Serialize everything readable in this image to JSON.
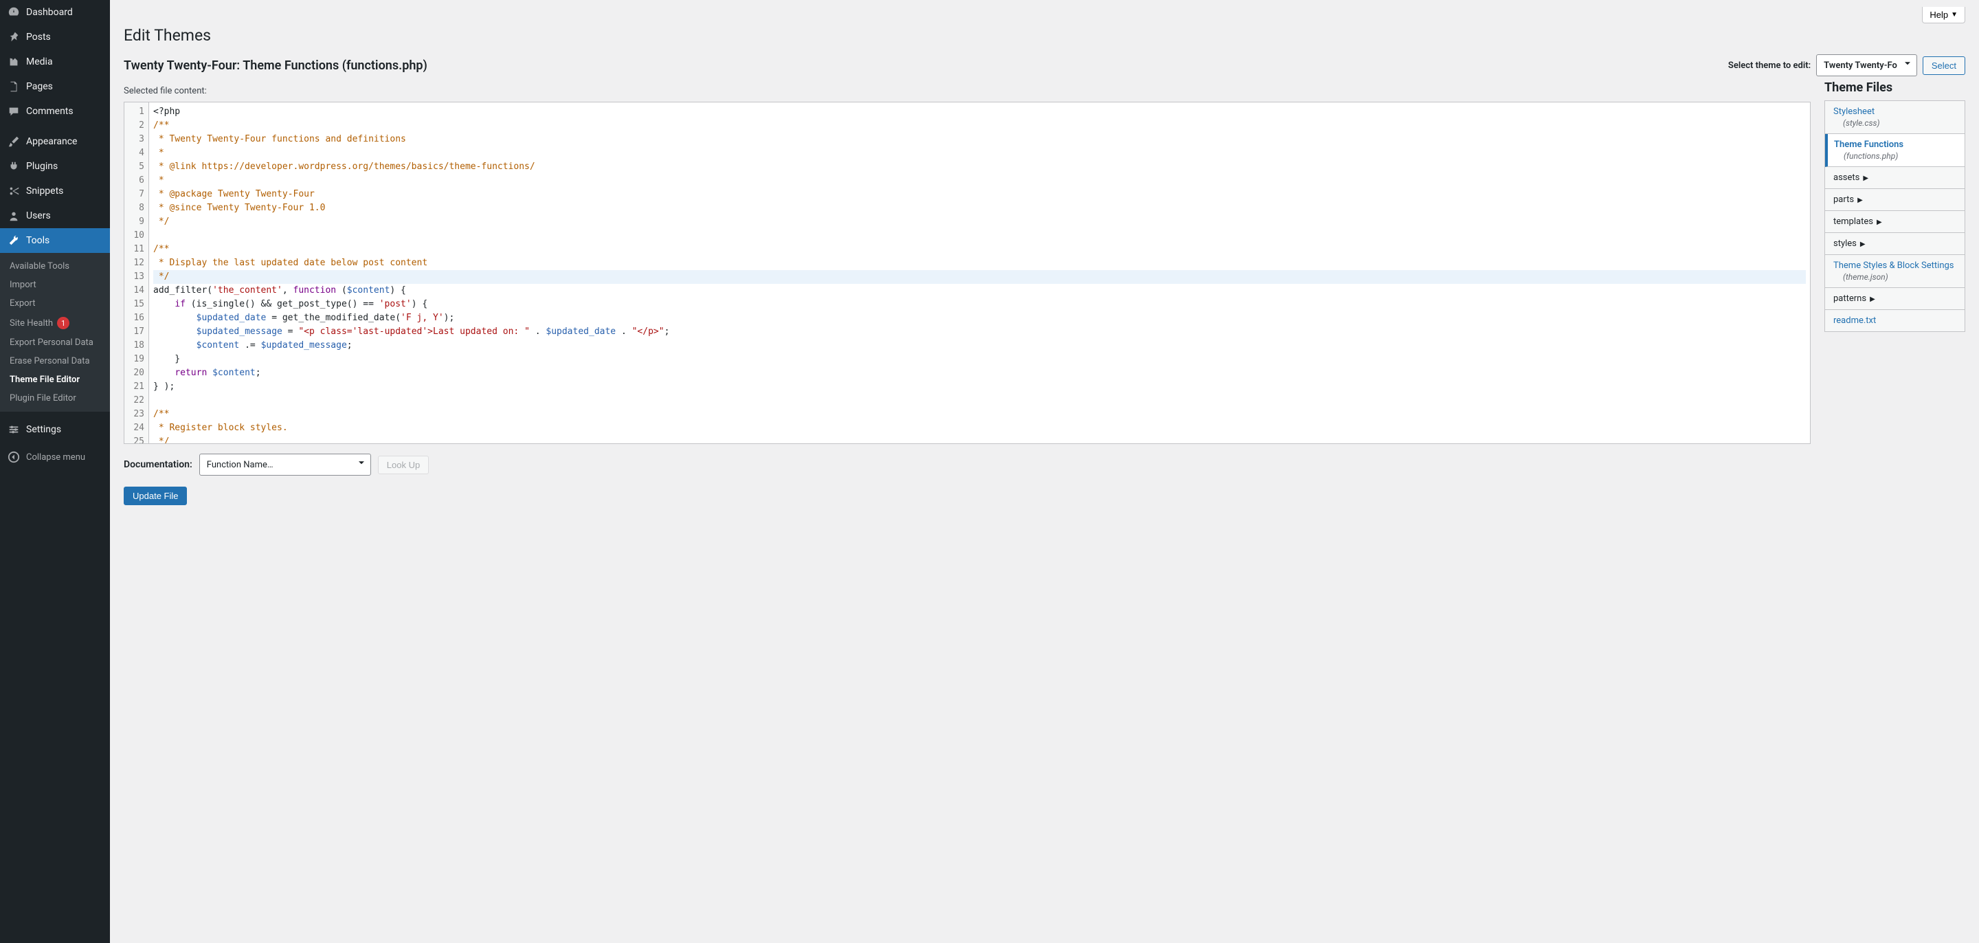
{
  "sidebar": {
    "items": [
      {
        "label": "Dashboard",
        "icon": "dashboard"
      },
      {
        "label": "Posts",
        "icon": "pin"
      },
      {
        "label": "Media",
        "icon": "media"
      },
      {
        "label": "Pages",
        "icon": "page"
      },
      {
        "label": "Comments",
        "icon": "comment"
      },
      {
        "label": "Appearance",
        "icon": "brush"
      },
      {
        "label": "Plugins",
        "icon": "plug"
      },
      {
        "label": "Snippets",
        "icon": "scissors"
      },
      {
        "label": "Users",
        "icon": "user"
      },
      {
        "label": "Tools",
        "icon": "wrench",
        "current": true
      },
      {
        "label": "Settings",
        "icon": "sliders"
      }
    ],
    "tools_submenu": [
      {
        "label": "Available Tools"
      },
      {
        "label": "Import"
      },
      {
        "label": "Export"
      },
      {
        "label": "Site Health",
        "badge": "1"
      },
      {
        "label": "Export Personal Data"
      },
      {
        "label": "Erase Personal Data"
      },
      {
        "label": "Theme File Editor",
        "current": true
      },
      {
        "label": "Plugin File Editor"
      }
    ],
    "collapse": "Collapse menu"
  },
  "help_label": "Help",
  "page_title": "Edit Themes",
  "file_heading": "Twenty Twenty-Four: Theme Functions (functions.php)",
  "theme_select": {
    "label": "Select theme to edit:",
    "value": "Twenty Twenty-Fo",
    "button": "Select"
  },
  "selected_file_label": "Selected file content:",
  "code_lines": [
    [
      {
        "t": "<?php",
        "c": ""
      }
    ],
    [
      {
        "t": "/**",
        "c": "c-cmt"
      }
    ],
    [
      {
        "t": " * Twenty Twenty-Four functions and definitions",
        "c": "c-cmt"
      }
    ],
    [
      {
        "t": " *",
        "c": "c-cmt"
      }
    ],
    [
      {
        "t": " * @link https://developer.wordpress.org/themes/basics/theme-functions/",
        "c": "c-cmt"
      }
    ],
    [
      {
        "t": " *",
        "c": "c-cmt"
      }
    ],
    [
      {
        "t": " * @package Twenty Twenty-Four",
        "c": "c-cmt"
      }
    ],
    [
      {
        "t": " * @since Twenty Twenty-Four 1.0",
        "c": "c-cmt"
      }
    ],
    [
      {
        "t": " */",
        "c": "c-cmt"
      }
    ],
    [
      {
        "t": "",
        "c": ""
      }
    ],
    [
      {
        "t": "/**",
        "c": "c-cmt"
      }
    ],
    [
      {
        "t": " * Display the last updated date below post content",
        "c": "c-cmt"
      }
    ],
    [
      {
        "t": " */",
        "c": "c-cmt"
      }
    ],
    [
      {
        "t": "add_filter(",
        "c": ""
      },
      {
        "t": "'the_content'",
        "c": "c-str"
      },
      {
        "t": ", ",
        "c": ""
      },
      {
        "t": "function",
        "c": "c-kw"
      },
      {
        "t": " (",
        "c": ""
      },
      {
        "t": "$content",
        "c": "c-var"
      },
      {
        "t": ") {",
        "c": ""
      }
    ],
    [
      {
        "t": "    ",
        "c": ""
      },
      {
        "t": "if",
        "c": "c-kw"
      },
      {
        "t": " (is_single() && get_post_type() == ",
        "c": ""
      },
      {
        "t": "'post'",
        "c": "c-str"
      },
      {
        "t": ") {",
        "c": ""
      }
    ],
    [
      {
        "t": "        ",
        "c": ""
      },
      {
        "t": "$updated_date",
        "c": "c-var"
      },
      {
        "t": " = get_the_modified_date(",
        "c": ""
      },
      {
        "t": "'F j, Y'",
        "c": "c-str"
      },
      {
        "t": ");",
        "c": ""
      }
    ],
    [
      {
        "t": "        ",
        "c": ""
      },
      {
        "t": "$updated_message",
        "c": "c-var"
      },
      {
        "t": " = ",
        "c": ""
      },
      {
        "t": "\"<p class='last-updated'>Last updated on: \"",
        "c": "c-str"
      },
      {
        "t": " . ",
        "c": ""
      },
      {
        "t": "$updated_date",
        "c": "c-var"
      },
      {
        "t": " . ",
        "c": ""
      },
      {
        "t": "\"</p>\"",
        "c": "c-str"
      },
      {
        "t": ";",
        "c": ""
      }
    ],
    [
      {
        "t": "        ",
        "c": ""
      },
      {
        "t": "$content",
        "c": "c-var"
      },
      {
        "t": " .= ",
        "c": ""
      },
      {
        "t": "$updated_message",
        "c": "c-var"
      },
      {
        "t": ";",
        "c": ""
      }
    ],
    [
      {
        "t": "    }",
        "c": ""
      }
    ],
    [
      {
        "t": "    ",
        "c": ""
      },
      {
        "t": "return",
        "c": "c-kw"
      },
      {
        "t": " ",
        "c": ""
      },
      {
        "t": "$content",
        "c": "c-var"
      },
      {
        "t": ";",
        "c": ""
      }
    ],
    [
      {
        "t": "} );",
        "c": ""
      }
    ],
    [
      {
        "t": "",
        "c": ""
      }
    ],
    [
      {
        "t": "/**",
        "c": "c-cmt"
      }
    ],
    [
      {
        "t": " * Register block styles.",
        "c": "c-cmt"
      }
    ],
    [
      {
        "t": " */",
        "c": "c-cmt"
      }
    ]
  ],
  "highlight_line": 13,
  "theme_files": {
    "heading": "Theme Files",
    "items": [
      {
        "label": "Stylesheet",
        "sub": "(style.css)"
      },
      {
        "label": "Theme Functions",
        "sub": "(functions.php)",
        "current": true
      },
      {
        "label": "assets",
        "folder": true
      },
      {
        "label": "parts",
        "folder": true
      },
      {
        "label": "templates",
        "folder": true
      },
      {
        "label": "styles",
        "folder": true
      },
      {
        "label": "Theme Styles & Block Settings",
        "sub": "(theme.json)"
      },
      {
        "label": "patterns",
        "folder": true
      },
      {
        "label": "readme.txt"
      }
    ]
  },
  "documentation": {
    "label": "Documentation:",
    "select": "Function Name…",
    "lookup": "Look Up"
  },
  "update_button": "Update File"
}
